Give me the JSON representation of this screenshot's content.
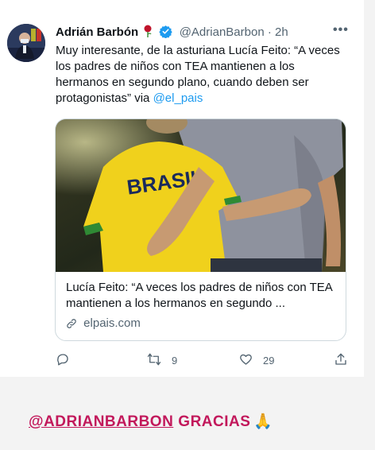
{
  "tweet": {
    "author_name": "Adrián Barbón",
    "handle": "@AdrianBarbon",
    "separator": " · ",
    "time": "2h",
    "more": "•••",
    "text_main": "Muy interesante, de la asturiana Lucía Feito: “A veces los padres de niños con TEA mantienen a los hermanos en segundo plano, cuando deben ser protagonistas” via ",
    "text_link": "@el_pais",
    "link_card": {
      "title": "Lucía Feito: “A veces los padres de niños con TEA mantienen a los hermanos en segundo ...",
      "domain": "elpais.com"
    },
    "actions": {
      "reply_count": "",
      "retweet_count": "9",
      "like_count": "29"
    }
  },
  "story": {
    "mention": "@ADRIANBARBON",
    "thanks": "GRACIAS",
    "emoji": "🙏"
  },
  "colors": {
    "link": "#1d9bf0",
    "verified": "#1d9bf0",
    "secondary_text": "#536471",
    "story_text": "#c2185b"
  }
}
